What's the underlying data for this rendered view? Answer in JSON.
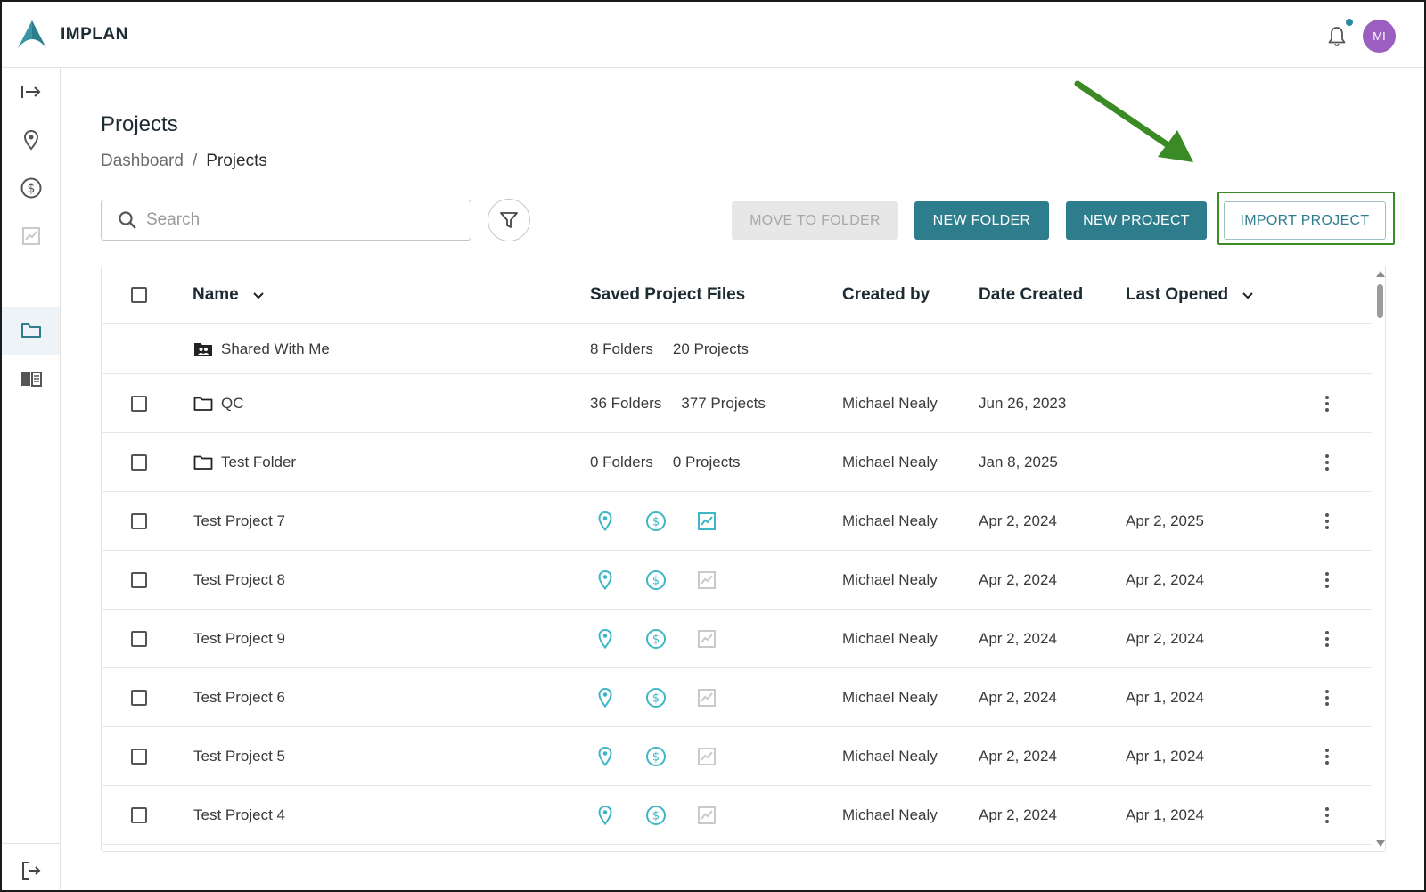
{
  "app": {
    "brand": "IMPLAN",
    "user_initials": "MI"
  },
  "colors": {
    "teal": "#2e7d8c",
    "accent_icon": "#3fb6c6",
    "avatar": "#9b5fc0",
    "highlight": "#3a8a25"
  },
  "page": {
    "title": "Projects",
    "breadcrumb": {
      "home": "Dashboard",
      "separator": "/",
      "current": "Projects"
    }
  },
  "toolbar": {
    "search_placeholder": "Search",
    "move_to_folder": "MOVE TO FOLDER",
    "new_folder": "NEW FOLDER",
    "new_project": "NEW PROJECT",
    "import_project": "IMPORT PROJECT"
  },
  "table": {
    "headers": {
      "name": "Name",
      "files": "Saved Project Files",
      "created_by": "Created by",
      "date_created": "Date Created",
      "last_opened": "Last Opened"
    },
    "shared": {
      "name": "Shared With Me",
      "folders": "8 Folders",
      "projects": "20 Projects"
    },
    "folders": [
      {
        "name": "QC",
        "folders": "36 Folders",
        "projects": "377 Projects",
        "created_by": "Michael Nealy",
        "date_created": "Jun 26, 2023"
      },
      {
        "name": "Test Folder",
        "folders": "0 Folders",
        "projects": "0 Projects",
        "created_by": "Michael Nealy",
        "date_created": "Jan 8, 2025"
      }
    ],
    "projects": [
      {
        "name": "Test Project 7",
        "created_by": "Michael Nealy",
        "date_created": "Apr 2, 2024",
        "last_opened": "Apr 2, 2025",
        "report_active": true
      },
      {
        "name": "Test Project 8",
        "created_by": "Michael Nealy",
        "date_created": "Apr 2, 2024",
        "last_opened": "Apr 2, 2024",
        "report_active": false
      },
      {
        "name": "Test Project 9",
        "created_by": "Michael Nealy",
        "date_created": "Apr 2, 2024",
        "last_opened": "Apr 2, 2024",
        "report_active": false
      },
      {
        "name": "Test Project 6",
        "created_by": "Michael Nealy",
        "date_created": "Apr 2, 2024",
        "last_opened": "Apr 1, 2024",
        "report_active": false
      },
      {
        "name": "Test Project 5",
        "created_by": "Michael Nealy",
        "date_created": "Apr 2, 2024",
        "last_opened": "Apr 1, 2024",
        "report_active": false
      },
      {
        "name": "Test Project 4",
        "created_by": "Michael Nealy",
        "date_created": "Apr 2, 2024",
        "last_opened": "Apr 1, 2024",
        "report_active": false
      }
    ]
  }
}
